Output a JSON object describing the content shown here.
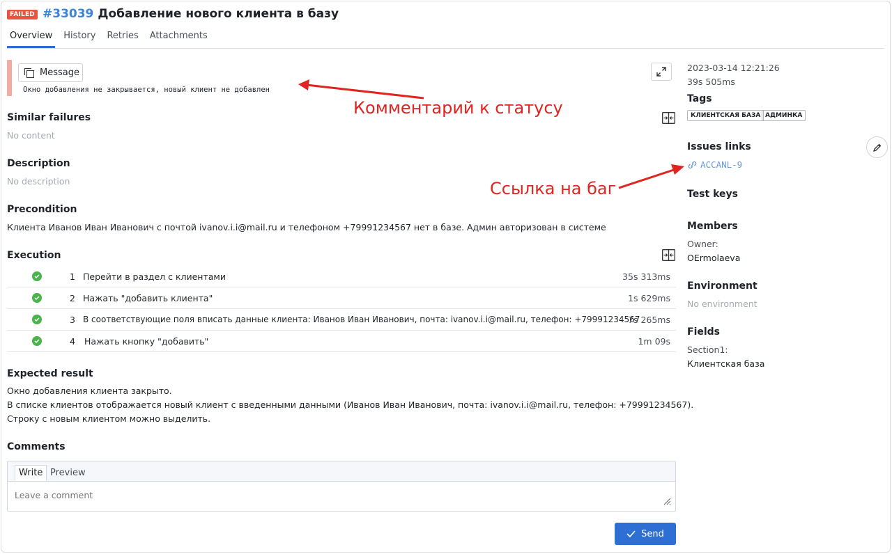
{
  "header": {
    "status": "FAILED",
    "id": "#33039",
    "title": "Добавление нового клиента в базу"
  },
  "tabs": [
    "Overview",
    "History",
    "Retries",
    "Attachments"
  ],
  "message": {
    "button_label": "Message",
    "text": "Окно добавления не закрывается, новый клиент не добавлен"
  },
  "similar_failures": {
    "heading": "Similar failures",
    "empty": "No content"
  },
  "description": {
    "heading": "Description",
    "empty": "No description"
  },
  "precondition": {
    "heading": "Precondition",
    "text": "Клиента Иванов Иван Иванович с почтой ivanov.i.i@mail.ru и телефоном +79991234567 нет в базе. Админ авторизован в системе"
  },
  "execution": {
    "heading": "Execution",
    "steps": [
      {
        "num": "1",
        "text": "Перейти в раздел с клиентами",
        "time": "35s 313ms"
      },
      {
        "num": "2",
        "text": "Нажать \"добавить клиента\"",
        "time": "1s 629ms"
      },
      {
        "num": "3",
        "text": "В соответствующие поля вписать данные клиента: Иванов Иван Иванович, почта: ivanov.i.i@mail.ru, телефон: +79991234567",
        "time": "7s 265ms"
      },
      {
        "num": "4",
        "text": "Нажать кнопку \"добавить\"",
        "time": "1m 09s"
      }
    ]
  },
  "expected": {
    "heading": "Expected result",
    "lines": [
      "Окно добавления клиента закрыто.",
      "В списке клиентов отображается новый клиент с введенными данными (Иванов Иван Иванович, почта: ivanov.i.i@mail.ru, телефон: +79991234567).",
      "Строку с новым клиентом можно выделить."
    ]
  },
  "comments": {
    "heading": "Comments",
    "tab_write": "Write",
    "tab_preview": "Preview",
    "placeholder": "Leave a comment",
    "send_label": "Send"
  },
  "sidebar": {
    "datetime": "2023-03-14 12:21:26",
    "duration": "39s 505ms",
    "tags_heading": "Tags",
    "tags": [
      "КЛИЕНТСКАЯ БАЗА",
      "АДМИНКА"
    ],
    "issues_heading": "Issues links",
    "issue": "ACCANL-9",
    "test_keys_heading": "Test keys",
    "members_heading": "Members",
    "owner_label": "Owner:",
    "owner": "OErmolaeva",
    "environment_heading": "Environment",
    "environment_empty": "No environment",
    "fields_heading": "Fields",
    "field_label": "Section1:",
    "field_value": "Клиентская база"
  },
  "annotations": {
    "status_comment": "Комментарий к статусу",
    "bug_link": "Ссылка на баг"
  },
  "colors": {
    "failed": "#e8553e",
    "accent": "#2d6fd2",
    "link": "#3a84d9",
    "passed": "#4bb34b",
    "annotation": "#e0241f"
  }
}
